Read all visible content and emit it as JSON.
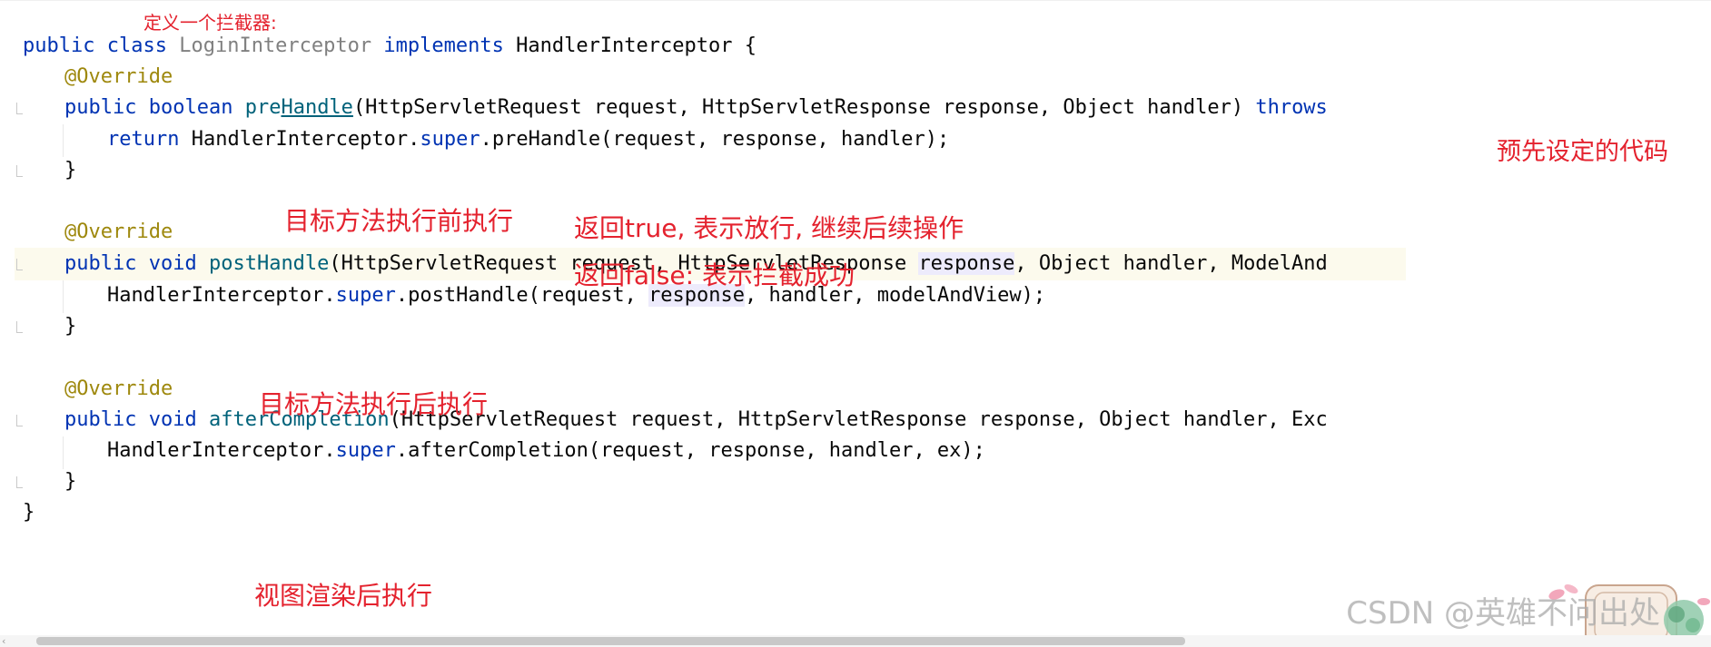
{
  "annotations": {
    "define_interceptor": "定义一个拦截器:",
    "predefined_code": "预先设定的代码",
    "before_target": "目标方法执行前执行",
    "return_true": "返回true, 表示放行, 继续后续操作",
    "return_false": "返回false: 表示拦截成功",
    "after_target": "目标方法执行后执行",
    "after_render": "视图渲染后执行"
  },
  "code": {
    "line1": {
      "kw_public": "public",
      "kw_class": "class",
      "class_name": "LoginInterceptor",
      "kw_implements": "implements",
      "interface_name": "HandlerInterceptor",
      "brace": "{"
    },
    "annotation_override": "@Override",
    "prehandle": {
      "kw_public": "public",
      "kw_type": "boolean",
      "name_pre": "pre",
      "name_handle": "Handle",
      "params": "(HttpServletRequest request, HttpServletResponse response, Object handler)",
      "kw_throws": "throws"
    },
    "prehandle_body": {
      "kw_return": "return",
      "call_prefix": "HandlerInterceptor.",
      "kw_super": "super",
      "call_suffix": ".preHandle(request, response, handler);"
    },
    "close_brace": "}",
    "posthandle": {
      "kw_public": "public",
      "kw_type": "void",
      "name": "postHandle",
      "params_a": "(HttpServletRequest request, HttpServletResponse ",
      "param_response": "response",
      "params_b": ", Object handler, ModelAnd"
    },
    "posthandle_body": {
      "call_prefix": "HandlerInterceptor.",
      "kw_super": "super",
      "call_mid": ".postHandle(request, ",
      "arg_response": "response",
      "call_suffix": ", handler, modelAndView);"
    },
    "aftercompletion": {
      "kw_public": "public",
      "kw_type": "void",
      "name": "afterCompletion",
      "params": "(HttpServletRequest request, HttpServletResponse response, Object handler, Exc"
    },
    "aftercompletion_body": {
      "call_prefix": "HandlerInterceptor.",
      "kw_super": "super",
      "call_suffix": ".afterCompletion(request, response, handler, ex);"
    }
  },
  "watermark": {
    "text": "CSDN @英雄不问出处"
  },
  "colors": {
    "keyword": "#0033b3",
    "annotation": "#9e880d",
    "method_name": "#00627a",
    "note_red": "#e4222e",
    "line_highlight": "#fcfaed",
    "usage_highlight": "#edebfc"
  }
}
